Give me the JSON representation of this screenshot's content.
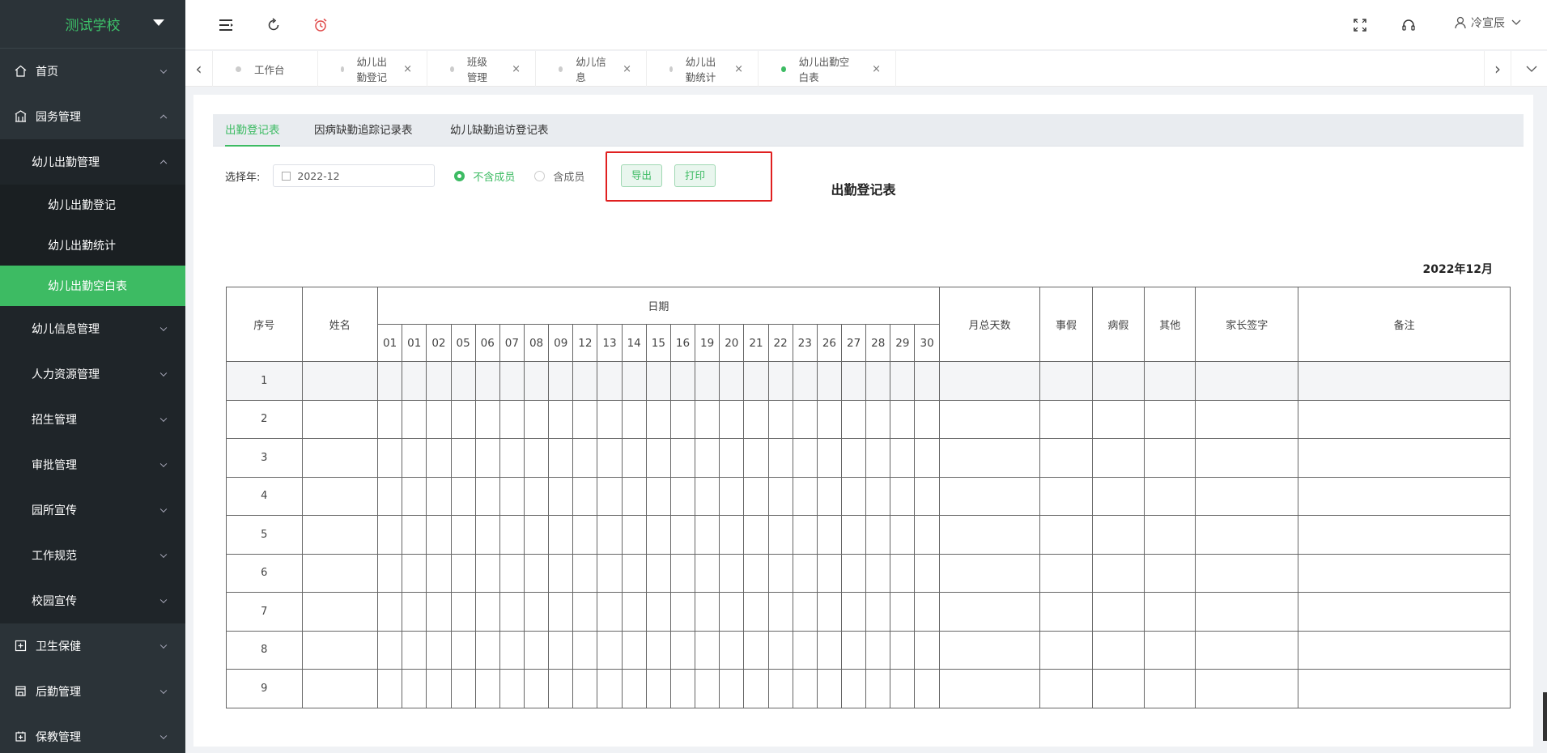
{
  "sidebar": {
    "school_name": "测试学校",
    "items": [
      {
        "label": "首页",
        "level": 1,
        "icon": "home-icon"
      },
      {
        "label": "园务管理",
        "level": 1,
        "icon": "building-icon",
        "open": true
      },
      {
        "label": "幼儿出勤管理",
        "level": 2,
        "open": true
      },
      {
        "label": "幼儿出勤登记",
        "level": 3
      },
      {
        "label": "幼儿出勤统计",
        "level": 3
      },
      {
        "label": "幼儿出勤空白表",
        "level": 3,
        "active": true
      },
      {
        "label": "幼儿信息管理",
        "level": 2
      },
      {
        "label": "人力资源管理",
        "level": 2
      },
      {
        "label": "招生管理",
        "level": 2
      },
      {
        "label": "审批管理",
        "level": 2
      },
      {
        "label": "园所宣传",
        "level": 2
      },
      {
        "label": "工作规范",
        "level": 2
      },
      {
        "label": "校园宣传",
        "level": 2
      },
      {
        "label": "卫生保健",
        "level": 1,
        "icon": "health-icon"
      },
      {
        "label": "后勤管理",
        "level": 1,
        "icon": "logistics-icon"
      },
      {
        "label": "保教管理",
        "level": 1,
        "icon": "education-icon"
      }
    ]
  },
  "header": {
    "user_name": "冷宣辰"
  },
  "tabs": [
    {
      "label": "工作台",
      "closable": false
    },
    {
      "label": "幼儿出勤登记",
      "closable": true
    },
    {
      "label": "班级管理",
      "closable": true
    },
    {
      "label": "幼儿信息",
      "closable": true
    },
    {
      "label": "幼儿出勤统计",
      "closable": true
    },
    {
      "label": "幼儿出勤空白表",
      "closable": true,
      "active": true
    }
  ],
  "subtabs": [
    "出勤登记表",
    "因病缺勤追踪记录表",
    "幼儿缺勤追访登记表"
  ],
  "filter": {
    "year_label": "选择年:",
    "year_value": "2022-12",
    "radio_exclude": "不含成员",
    "radio_include": "含成员",
    "export_label": "导出",
    "print_label": "打印"
  },
  "sheet": {
    "title": "出勤登记表",
    "month": "2022年12月",
    "headers": {
      "index": "序号",
      "name": "姓名",
      "date": "日期",
      "total_days": "月总天数",
      "personal_leave": "事假",
      "sick_leave": "病假",
      "other": "其他",
      "parent_sign": "家长签字",
      "remarks": "备注"
    },
    "days": [
      "01",
      "01",
      "02",
      "05",
      "06",
      "07",
      "08",
      "09",
      "12",
      "13",
      "14",
      "15",
      "16",
      "19",
      "20",
      "21",
      "22",
      "23",
      "26",
      "27",
      "28",
      "29",
      "30"
    ],
    "rows": [
      "1",
      "2",
      "3",
      "4",
      "5",
      "6",
      "7",
      "8",
      "9"
    ]
  },
  "colors": {
    "accent": "#3dbb63",
    "sidebar_bg": "#2b3338",
    "highlight": "#e02020"
  }
}
